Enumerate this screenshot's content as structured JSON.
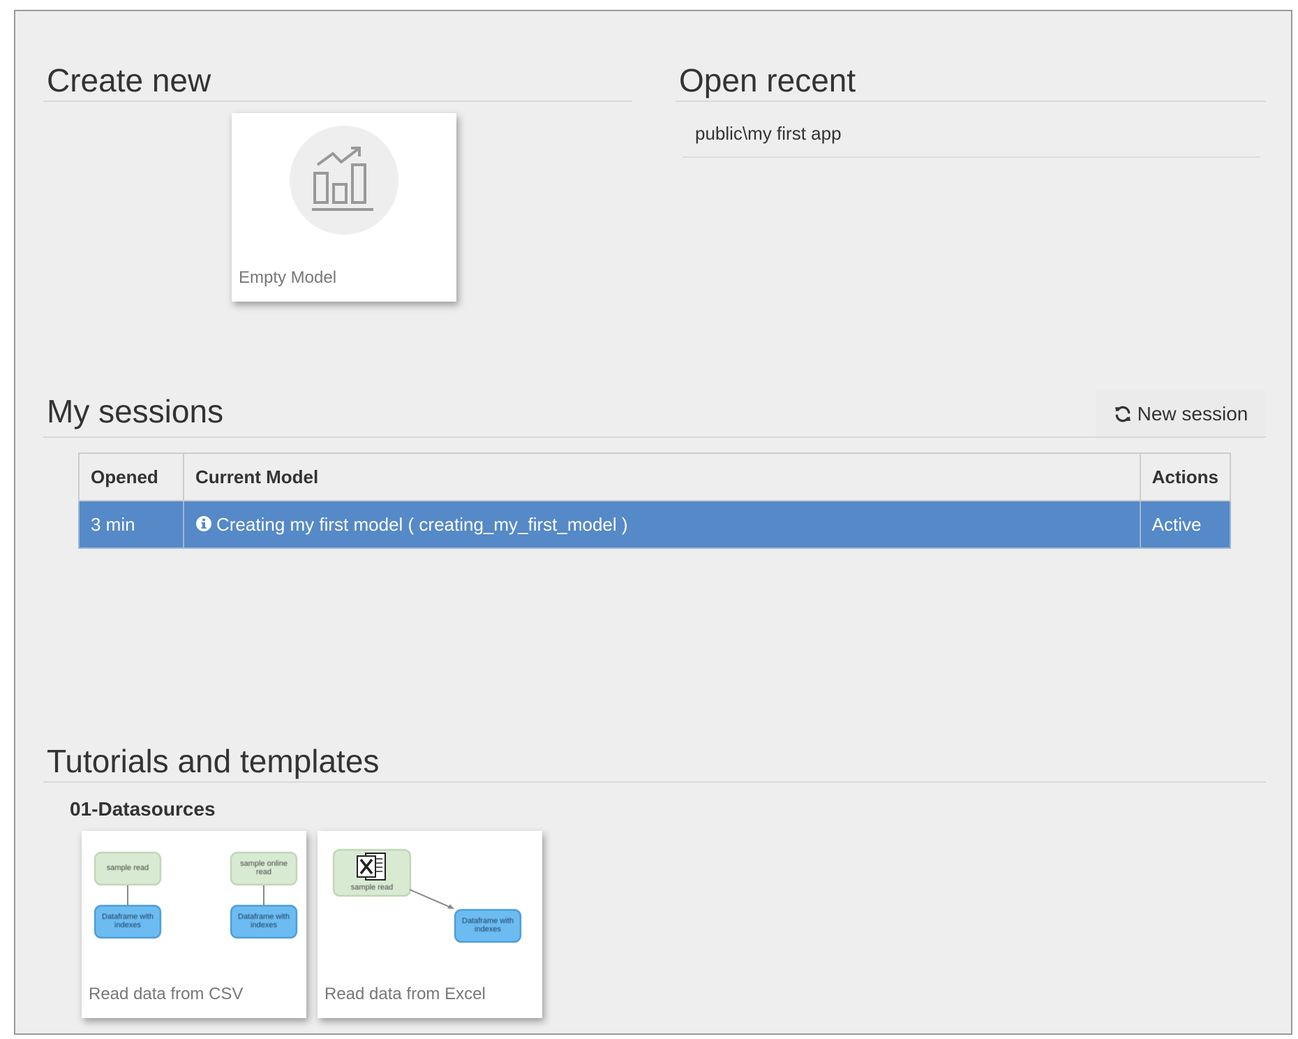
{
  "create_new": {
    "title": "Create new",
    "tiles": [
      {
        "label": "Empty Model",
        "icon": "bar-chart-growth-icon"
      }
    ]
  },
  "open_recent": {
    "title": "Open recent",
    "items": [
      {
        "label": "public\\my first app"
      }
    ]
  },
  "sessions": {
    "title": "My sessions",
    "new_session_label": "New session",
    "new_session_icon": "refresh-icon",
    "columns": [
      "Opened",
      "Current Model",
      "Actions"
    ],
    "rows": [
      {
        "opened": "3 min",
        "model": "Creating my first model ( creating_my_first_model )",
        "action": "Active",
        "selected": true,
        "icon": "info-circle-icon"
      }
    ],
    "selected_row_color": "#5589c7"
  },
  "tutorials": {
    "title": "Tutorials and templates",
    "categories": [
      {
        "name": "01-Datasources",
        "templates": [
          {
            "label": "Read data from CSV",
            "nodes": {
              "a_top": "sample read",
              "a_bottom": "Dataframe with indexes",
              "b_top": "sample online read",
              "b_bottom": "Dataframe with indexes"
            }
          },
          {
            "label": "Read data from Excel",
            "nodes": {
              "source": "sample read",
              "target": "Dataframe with indexes"
            },
            "icon": "excel-file-icon"
          }
        ]
      }
    ]
  }
}
